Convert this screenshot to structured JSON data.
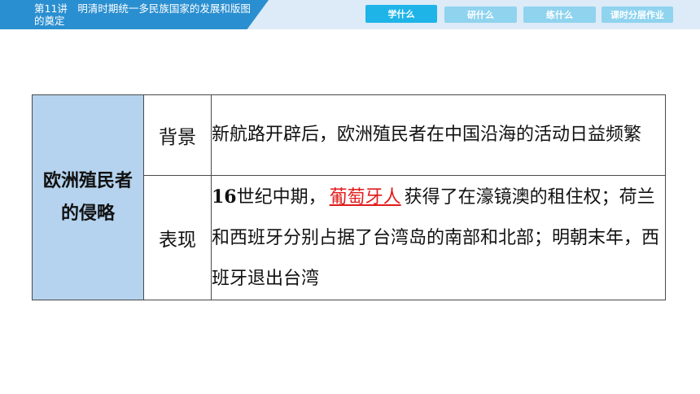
{
  "header": {
    "title": "第11讲　明清时期统一多民族国家的发展和版图的奠定",
    "tabs": [
      {
        "label": "学什么",
        "active": true
      },
      {
        "label": "研什么",
        "active": false
      },
      {
        "label": "练什么",
        "active": false
      },
      {
        "label": "课时分层作业",
        "active": false
      }
    ]
  },
  "table": {
    "category": "欧洲殖民者的侵略",
    "rows": [
      {
        "label": "背景",
        "text": "新航路开辟后，欧洲殖民者在中国沿海的活动日益频繁"
      },
      {
        "label": "表现",
        "text_prefix_num": "16",
        "text_prefix": "世纪中期，",
        "answer": "葡萄牙人",
        "text_suffix": "获得了在濠镜澳的租住权；荷兰和西班牙分别占据了台湾岛的南部和北部；明朝末年，西班牙退出台湾"
      }
    ]
  },
  "colors": {
    "banner": "#2a8fd0",
    "topbar": "#dcebf7",
    "tab_active": "#1fb4e8",
    "tab_inactive": "#8fd3ef",
    "category_bg": "#b5d3ee",
    "answer": "#e21a1a"
  }
}
